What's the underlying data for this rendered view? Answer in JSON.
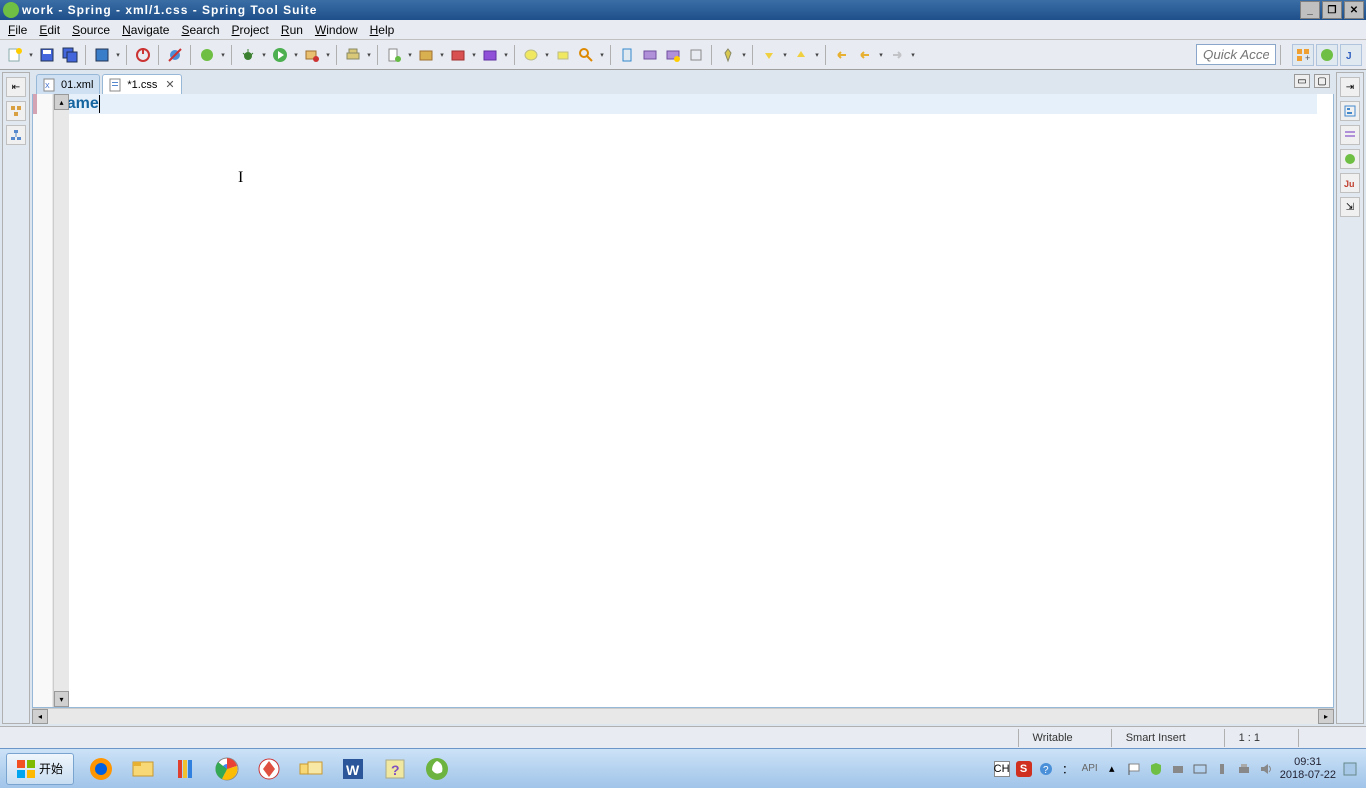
{
  "title": "work - Spring - xml/1.css - Spring Tool Suite",
  "menu": [
    "File",
    "Edit",
    "Source",
    "Navigate",
    "Search",
    "Project",
    "Run",
    "Window",
    "Help"
  ],
  "quick_access": "Quick Access",
  "tabs": [
    {
      "label": "01.xml",
      "active": false
    },
    {
      "label": "*1.css",
      "active": true
    }
  ],
  "editor": {
    "content": "name"
  },
  "status": {
    "writable": "Writable",
    "insert": "Smart Insert",
    "pos": "1 : 1"
  },
  "task_start": "开始",
  "tray": {
    "lang": "CH",
    "api": "API",
    "time": "09:31",
    "date": "2018-07-22"
  }
}
